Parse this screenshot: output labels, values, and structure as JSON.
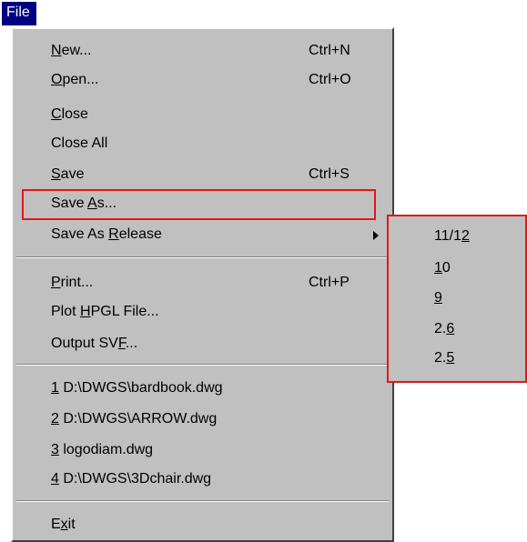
{
  "menubar": {
    "file_label": "File"
  },
  "file_menu": {
    "items": [
      {
        "label": "New...",
        "shortcut": "Ctrl+N",
        "mnemonic": "N"
      },
      {
        "label": "Open...",
        "shortcut": "Ctrl+O",
        "mnemonic": "O"
      },
      {
        "label": "Close",
        "shortcut": "",
        "mnemonic": "C"
      },
      {
        "label": "Close All",
        "shortcut": "",
        "mnemonic": ""
      },
      {
        "label": "Save",
        "shortcut": "Ctrl+S",
        "mnemonic": "S"
      },
      {
        "label": "Save As...",
        "shortcut": "",
        "mnemonic": "A"
      },
      {
        "label": "Save As Release",
        "shortcut": "",
        "mnemonic": "R",
        "has_submenu": true
      },
      {
        "label": "Print...",
        "shortcut": "Ctrl+P",
        "mnemonic": "P"
      },
      {
        "label": "Plot HPGL File...",
        "shortcut": "",
        "mnemonic": "H"
      },
      {
        "label": "Output SVF...",
        "shortcut": "",
        "mnemonic": "F"
      },
      {
        "label": "1 D:\\DWGS\\bardbook.dwg",
        "shortcut": "",
        "mnemonic": "1"
      },
      {
        "label": "2 D:\\DWGS\\ARROW.dwg",
        "shortcut": "",
        "mnemonic": "2"
      },
      {
        "label": "3 logodiam.dwg",
        "shortcut": "",
        "mnemonic": "3"
      },
      {
        "label": "4 D:\\DWGS\\3Dchair.dwg",
        "shortcut": "",
        "mnemonic": "4"
      },
      {
        "label": "Exit",
        "shortcut": "",
        "mnemonic": "x"
      }
    ]
  },
  "save_as_release_submenu": {
    "items": [
      {
        "label": "11/12",
        "mnemonic": "2"
      },
      {
        "label": "10",
        "mnemonic": "1"
      },
      {
        "label": "9",
        "mnemonic": "9"
      },
      {
        "label": "2.6",
        "mnemonic": "6"
      },
      {
        "label": "2.5",
        "mnemonic": "5"
      }
    ]
  },
  "colors": {
    "menu_bg": "#c0c0c0",
    "menubar_selected_bg": "#000080",
    "annotation_box": "#e01818"
  }
}
